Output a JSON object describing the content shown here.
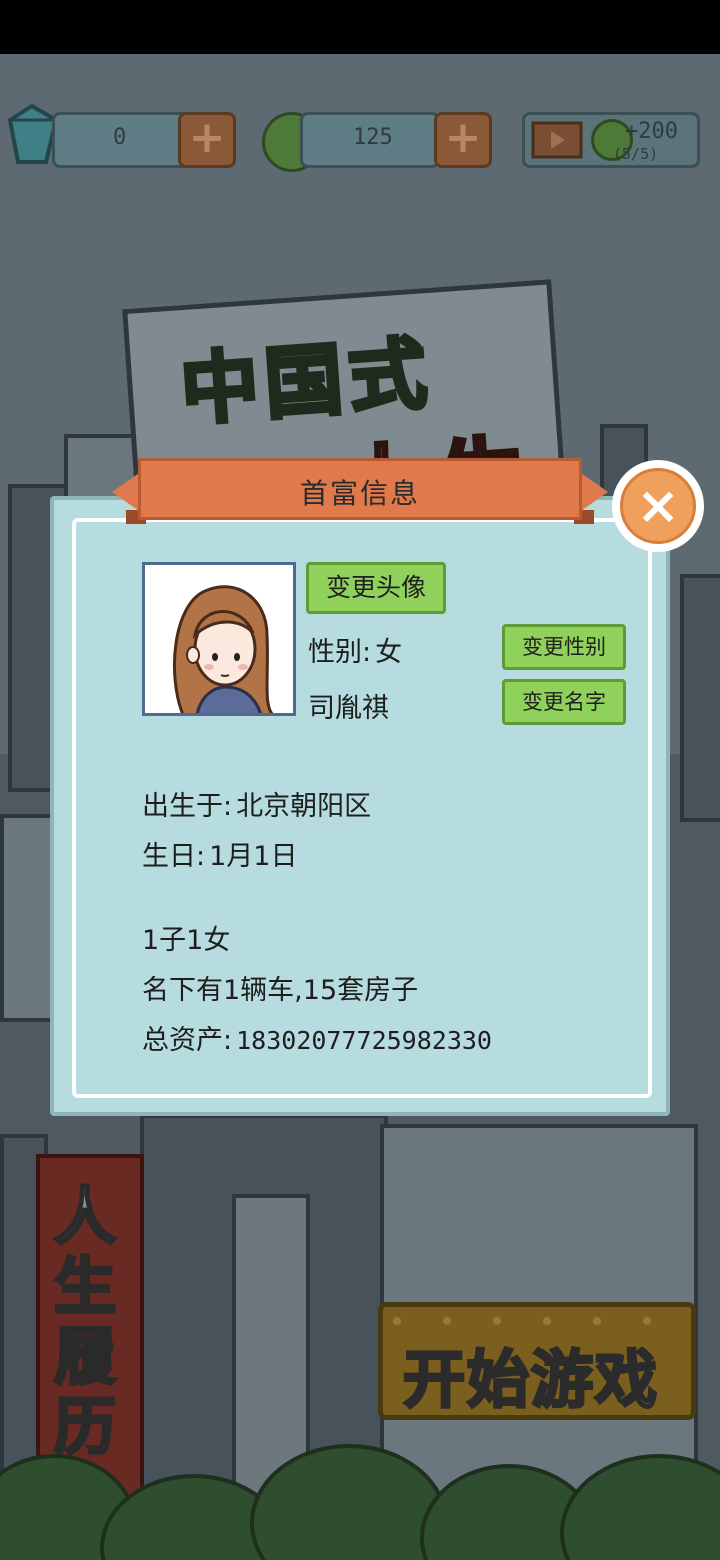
{
  "topbar": {
    "gems": "0",
    "coins": "125",
    "video_reward": "+200",
    "video_count": "(5/5)",
    "plus_symbol": "+"
  },
  "background": {
    "logo_line1": "中国式",
    "logo_line2": "人生",
    "side_sign": "人生履历",
    "start_button": "开始游戏"
  },
  "dialog": {
    "title": "首富信息",
    "close_symbol": "×",
    "change_avatar": "变更头像",
    "change_gender": "变更性别",
    "change_name": "变更名字",
    "gender_label": "性别:",
    "gender_value": "女",
    "name": "司胤祺",
    "birthplace_label": "出生于:",
    "birthplace_value": "北京朝阳区",
    "birthday_label": "生日:",
    "birthday_value": "1月1日",
    "children": "1子1女",
    "property": "名下有1辆车,15套房子",
    "assets_label": "总资产:",
    "assets_value": "18302077725982330"
  },
  "colors": {
    "dialog_bg": "#b7dcdf",
    "ribbon": "#e0794b",
    "button_green": "#90d15b",
    "close_orange": "#f0a05c"
  }
}
